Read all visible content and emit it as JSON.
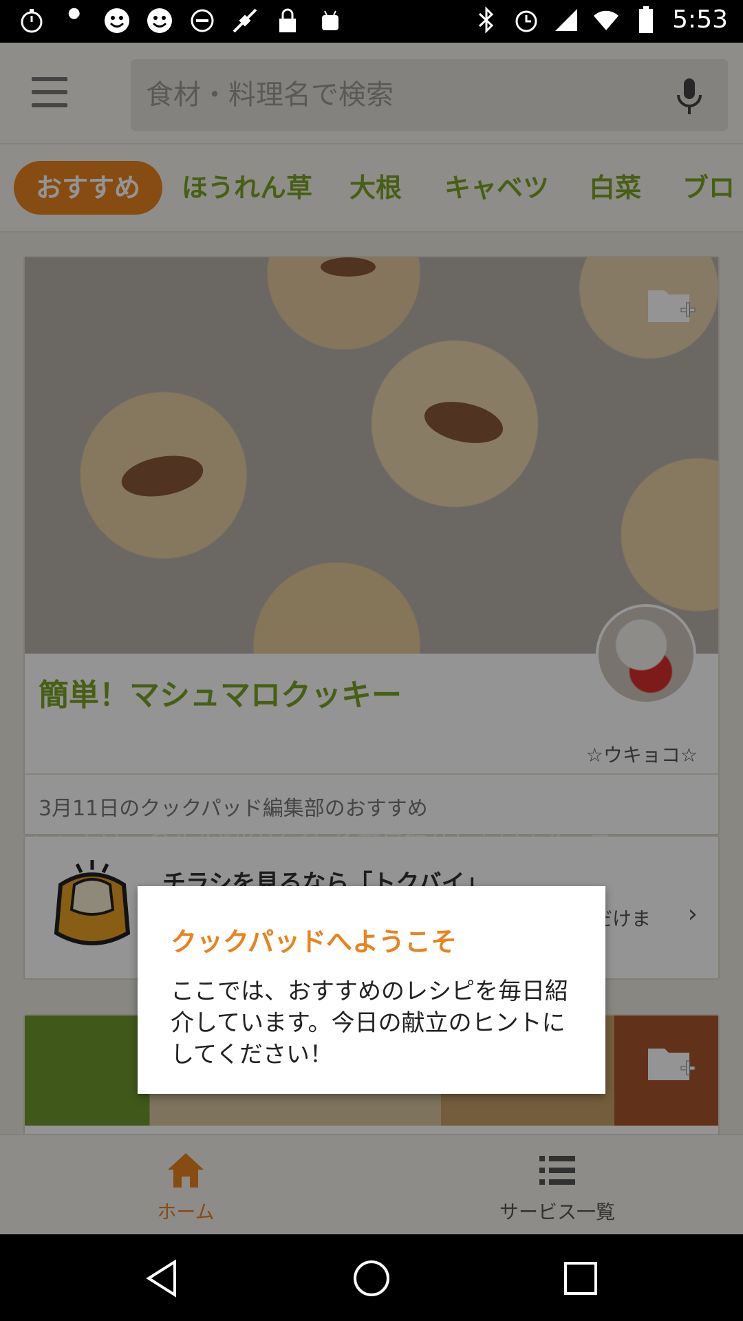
{
  "status_bar": {
    "time": "5:53",
    "left_icons": [
      "stopwatch-icon",
      "wrench-icon",
      "smiley-icon",
      "smiley-icon",
      "do-not-disturb-icon",
      "fake-gps-icon",
      "lock-icon",
      "android-icon"
    ],
    "right_icons": [
      "bluetooth-icon",
      "alarm-icon",
      "signal-icon",
      "wifi-icon",
      "battery-icon"
    ]
  },
  "header": {
    "search_placeholder": "食材・料理名で検索"
  },
  "tabs": [
    {
      "label": "おすすめ",
      "active": true
    },
    {
      "label": "ほうれん草",
      "active": false
    },
    {
      "label": "大根",
      "active": false
    },
    {
      "label": "キャベツ",
      "active": false
    },
    {
      "label": "白菜",
      "active": false
    },
    {
      "label": "ブロ",
      "active": false
    }
  ],
  "feed": {
    "recipe": {
      "title": "簡単！マシュマロクッキー",
      "author": "☆ウキョコ☆",
      "footer": "3月11日のクックパッド編集部のおすすめ"
    },
    "promo": {
      "title": "チラシを見るなら「トクバイ」",
      "subtitle": "だけま"
    },
    "ghost_text": "ここでは、おすすめのレシピを毎日紹介しています。今"
  },
  "bottom_nav": {
    "home_label": "ホーム",
    "services_label": "サービス一覧"
  },
  "dialog": {
    "title": "クックパッドへようこそ",
    "body": "ここでは、おすすめのレシピを毎日紹介しています。今日の献立のヒントにしてください！"
  },
  "colors": {
    "accent": "#e8831f",
    "green": "#7aa424"
  }
}
